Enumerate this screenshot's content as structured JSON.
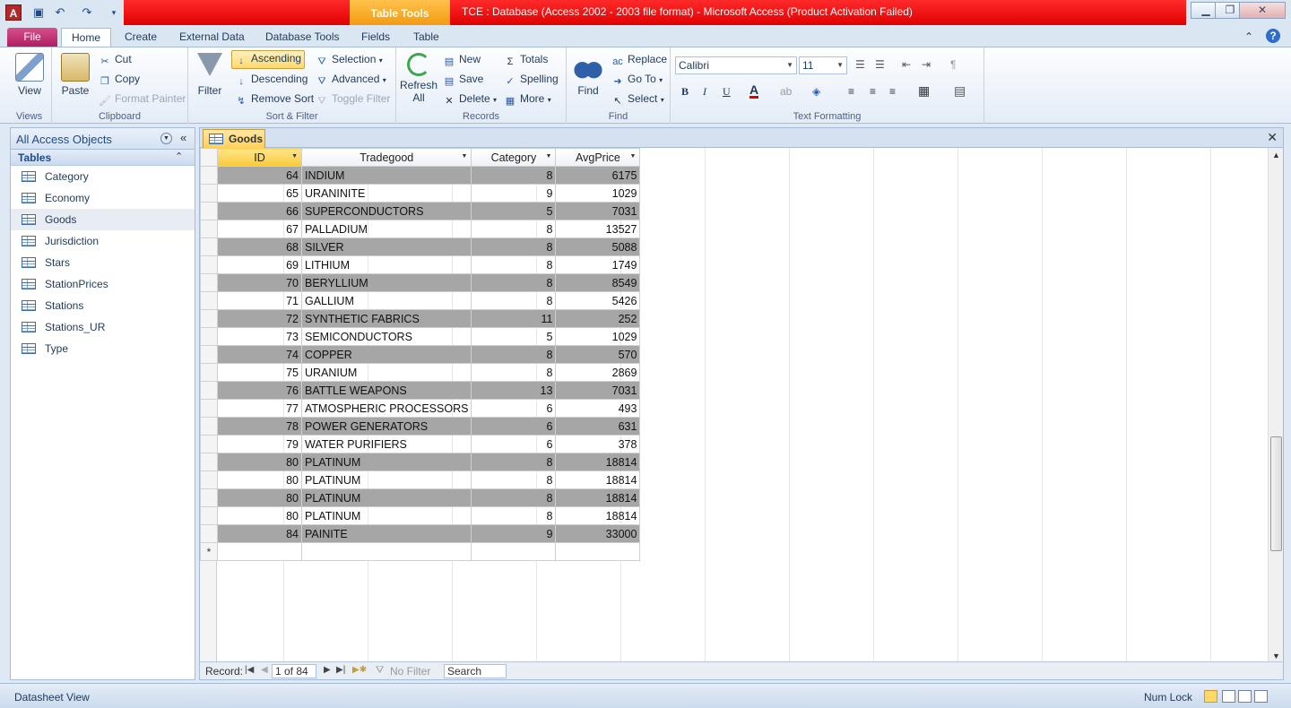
{
  "window": {
    "title": "TCE : Database (Access 2002 - 2003 file format)  -  Microsoft Access (Product Activation Failed)",
    "contextual_tab_group": "Table Tools",
    "minimize_glyph": "▁",
    "restore_glyph": "❐",
    "close_glyph": "✕"
  },
  "ribbon_tabs": [
    "File",
    "Home",
    "Create",
    "External Data",
    "Database Tools",
    "Fields",
    "Table"
  ],
  "ribbon": {
    "views": {
      "label": "Views",
      "view": "View"
    },
    "clipboard": {
      "label": "Clipboard",
      "paste": "Paste",
      "cut": "Cut",
      "copy": "Copy",
      "format_painter": "Format Painter"
    },
    "sort_filter": {
      "label": "Sort & Filter",
      "filter": "Filter",
      "ascending": "Ascending",
      "descending": "Descending",
      "remove_sort": "Remove Sort",
      "selection": "Selection",
      "advanced": "Advanced",
      "toggle_filter": "Toggle Filter"
    },
    "records": {
      "label": "Records",
      "refresh": "Refresh",
      "refresh_sub": "All",
      "new": "New",
      "save": "Save",
      "delete": "Delete",
      "totals": "Totals",
      "spelling": "Spelling",
      "more": "More"
    },
    "find": {
      "label": "Find",
      "find": "Find",
      "replace": "Replace",
      "go_to": "Go To",
      "select": "Select"
    },
    "text_formatting": {
      "label": "Text Formatting",
      "font": "Calibri",
      "size": "11",
      "bold": "B",
      "italic": "I",
      "underline": "U",
      "font_color": "A"
    }
  },
  "nav_pane": {
    "title": "All Access Objects",
    "section": "Tables",
    "items": [
      "Category",
      "Economy",
      "Goods",
      "Jurisdiction",
      "Stars",
      "StationPrices",
      "Stations",
      "Stations_UR",
      "Type"
    ],
    "active_index": 2
  },
  "document": {
    "tab_label": "Goods",
    "columns": [
      "ID",
      "Tradegood",
      "Category",
      "AvgPrice"
    ],
    "new_row_marker": "*",
    "rows": [
      {
        "id": "64",
        "tradegood": "INDIUM",
        "category": "8",
        "avgprice": "6175"
      },
      {
        "id": "65",
        "tradegood": "URANINITE",
        "category": "9",
        "avgprice": "1029"
      },
      {
        "id": "66",
        "tradegood": "SUPERCONDUCTORS",
        "category": "5",
        "avgprice": "7031"
      },
      {
        "id": "67",
        "tradegood": "PALLADIUM",
        "category": "8",
        "avgprice": "13527"
      },
      {
        "id": "68",
        "tradegood": "SILVER",
        "category": "8",
        "avgprice": "5088"
      },
      {
        "id": "69",
        "tradegood": "LITHIUM",
        "category": "8",
        "avgprice": "1749"
      },
      {
        "id": "70",
        "tradegood": "BERYLLIUM",
        "category": "8",
        "avgprice": "8549"
      },
      {
        "id": "71",
        "tradegood": "GALLIUM",
        "category": "8",
        "avgprice": "5426"
      },
      {
        "id": "72",
        "tradegood": "SYNTHETIC FABRICS",
        "category": "11",
        "avgprice": "252"
      },
      {
        "id": "73",
        "tradegood": "SEMICONDUCTORS",
        "category": "5",
        "avgprice": "1029"
      },
      {
        "id": "74",
        "tradegood": "COPPER",
        "category": "8",
        "avgprice": "570"
      },
      {
        "id": "75",
        "tradegood": "URANIUM",
        "category": "8",
        "avgprice": "2869"
      },
      {
        "id": "76",
        "tradegood": "BATTLE WEAPONS",
        "category": "13",
        "avgprice": "7031"
      },
      {
        "id": "77",
        "tradegood": "ATMOSPHERIC PROCESSORS",
        "category": "6",
        "avgprice": "493"
      },
      {
        "id": "78",
        "tradegood": "POWER GENERATORS",
        "category": "6",
        "avgprice": "631"
      },
      {
        "id": "79",
        "tradegood": "WATER PURIFIERS",
        "category": "6",
        "avgprice": "378"
      },
      {
        "id": "80",
        "tradegood": "PLATINUM",
        "category": "8",
        "avgprice": "18814"
      },
      {
        "id": "80",
        "tradegood": "PLATINUM",
        "category": "8",
        "avgprice": "18814"
      },
      {
        "id": "80",
        "tradegood": "PLATINUM",
        "category": "8",
        "avgprice": "18814"
      },
      {
        "id": "80",
        "tradegood": "PLATINUM",
        "category": "8",
        "avgprice": "18814"
      },
      {
        "id": "84",
        "tradegood": "PAINITE",
        "category": "9",
        "avgprice": "33000"
      }
    ]
  },
  "record_nav": {
    "label": "Record:",
    "position": "1 of 84",
    "filter": "No Filter",
    "search": "Search"
  },
  "status_bar": {
    "left": "Datasheet View",
    "num_lock": "Num Lock"
  },
  "colors": {
    "title_bar": "#e00000",
    "file_tab": "#b01e61",
    "table_tools": "#f39a12",
    "alt_row": "#a6a6a6"
  }
}
